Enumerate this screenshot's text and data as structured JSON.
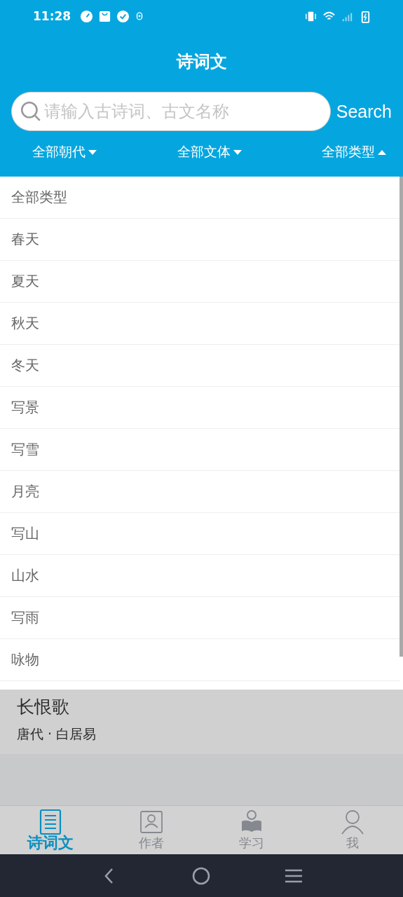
{
  "status_bar": {
    "time": "11:28"
  },
  "header": {
    "title": "诗词文"
  },
  "search": {
    "placeholder": "请输入古诗词、古文名称",
    "button": "Search"
  },
  "filters": [
    {
      "label": "全部朝代",
      "expanded": false
    },
    {
      "label": "全部文体",
      "expanded": false
    },
    {
      "label": "全部类型",
      "expanded": true
    }
  ],
  "type_options": [
    "全部类型",
    "春天",
    "夏天",
    "秋天",
    "冬天",
    "写景",
    "写雪",
    "月亮",
    "写山",
    "山水",
    "写雨",
    "咏物"
  ],
  "poem": {
    "title": "长恨歌",
    "meta": "唐代 · 白居易"
  },
  "tabs": [
    {
      "label": "诗词文",
      "selected": true,
      "kind": "doc"
    },
    {
      "label": "作者",
      "selected": false,
      "kind": "author"
    },
    {
      "label": "学习",
      "selected": false,
      "kind": "study"
    },
    {
      "label": "我",
      "selected": false,
      "kind": "me"
    }
  ]
}
